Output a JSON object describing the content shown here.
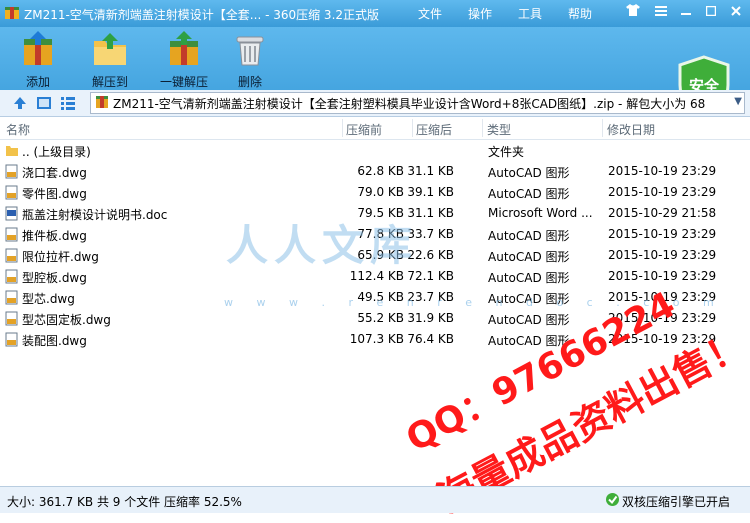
{
  "window": {
    "title": "ZM211-空气清新剂端盖注射模设计【全套... - 360压缩 3.2正式版",
    "menu": [
      "文件",
      "操作",
      "工具",
      "帮助"
    ],
    "controls": [
      "shirt-icon",
      "menu-lines-icon",
      "minimize",
      "maximize",
      "close"
    ]
  },
  "toolbar": {
    "buttons": [
      {
        "label": "添加",
        "icon": "add-archive-icon"
      },
      {
        "label": "解压到",
        "icon": "extract-to-icon"
      },
      {
        "label": "一键解压",
        "icon": "one-click-extract-icon"
      },
      {
        "label": "删除",
        "icon": "trash-icon"
      }
    ],
    "security_badge": "安全"
  },
  "address": {
    "path": "ZM211-空气清新剂端盖注射模设计【全套注射塑料模具毕业设计含Word+8张CAD图纸】.zip - 解包大小为 68"
  },
  "columns": [
    "名称",
    "压缩前",
    "压缩后",
    "类型",
    "修改日期"
  ],
  "rows": [
    {
      "name": ".. (上级目录)",
      "size": "",
      "packed": "",
      "type": "文件夹",
      "date": "",
      "icon": "folder-up-icon"
    },
    {
      "name": "浇口套.dwg",
      "size": "62.8 KB",
      "packed": "31.1 KB",
      "type": "AutoCAD 图形",
      "date": "2015-10-19 23:29",
      "icon": "dwg-file-icon"
    },
    {
      "name": "零件图.dwg",
      "size": "79.0 KB",
      "packed": "39.1 KB",
      "type": "AutoCAD 图形",
      "date": "2015-10-19 23:29",
      "icon": "dwg-file-icon"
    },
    {
      "name": "瓶盖注射模设计说明书.doc",
      "size": "79.5 KB",
      "packed": "31.1 KB",
      "type": "Microsoft Word ...",
      "date": "2015-10-29 21:58",
      "icon": "doc-file-icon"
    },
    {
      "name": "推件板.dwg",
      "size": "77.8 KB",
      "packed": "33.7 KB",
      "type": "AutoCAD 图形",
      "date": "2015-10-19 23:29",
      "icon": "dwg-file-icon"
    },
    {
      "name": "限位拉杆.dwg",
      "size": "65.9 KB",
      "packed": "22.6 KB",
      "type": "AutoCAD 图形",
      "date": "2015-10-19 23:29",
      "icon": "dwg-file-icon"
    },
    {
      "name": "型腔板.dwg",
      "size": "112.4 KB",
      "packed": "72.1 KB",
      "type": "AutoCAD 图形",
      "date": "2015-10-19 23:29",
      "icon": "dwg-file-icon"
    },
    {
      "name": "型芯.dwg",
      "size": "49.5 KB",
      "packed": "23.7 KB",
      "type": "AutoCAD 图形",
      "date": "2015-10-19 23:29",
      "icon": "dwg-file-icon"
    },
    {
      "name": "型芯固定板.dwg",
      "size": "55.2 KB",
      "packed": "31.9 KB",
      "type": "AutoCAD 图形",
      "date": "2015-10-19 23:29",
      "icon": "dwg-file-icon"
    },
    {
      "name": "装配图.dwg",
      "size": "107.3 KB",
      "packed": "76.4 KB",
      "type": "AutoCAD 图形",
      "date": "2015-10-19 23:29",
      "icon": "dwg-file-icon"
    }
  ],
  "status": {
    "summary": "大小: 361.7 KB 共 9 个文件 压缩率 52.5%",
    "engine": "双核压缩引擎已开启"
  },
  "watermarks": {
    "site": "人人文库",
    "url": "w w w . r e n r e n d o c . c o m",
    "qq": "QQ：97666224",
    "slogan": "海量成品资料出售！"
  }
}
